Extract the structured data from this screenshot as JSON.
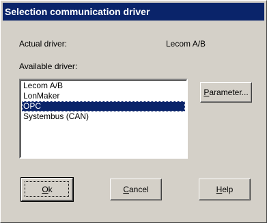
{
  "window": {
    "title": "Selection communication driver"
  },
  "actual_driver": {
    "label": "Actual driver:",
    "value": "Lecom A/B"
  },
  "available_driver": {
    "label": "Available driver:",
    "items": [
      "Lecom A/B",
      "LonMaker",
      "OPC",
      "Systembus (CAN)"
    ],
    "selected_index": 2
  },
  "buttons": {
    "parameter": {
      "mnemonic": "P",
      "rest": "arameter..."
    },
    "ok": {
      "mnemonic": "O",
      "rest": "k"
    },
    "cancel": {
      "mnemonic": "C",
      "rest": "ancel"
    },
    "help": {
      "mnemonic": "H",
      "rest": "elp"
    }
  },
  "colors": {
    "face": "#d4d0c8",
    "title_bg": "#0a246a",
    "selection_bg": "#0a246a"
  }
}
